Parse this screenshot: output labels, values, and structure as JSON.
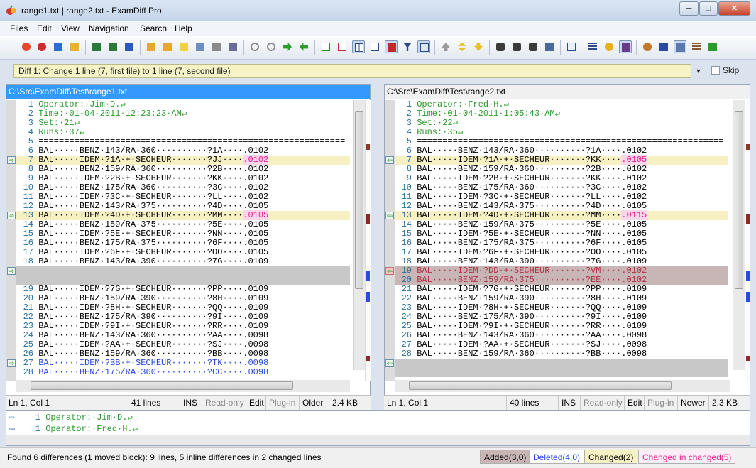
{
  "window": {
    "title": "range1.txt  |  range2.txt - ExamDiff Pro",
    "min": "─",
    "max": "□",
    "close": "✕"
  },
  "menu": [
    "Files",
    "Edit",
    "View",
    "Navigation",
    "Search",
    "Help"
  ],
  "diff_nav": {
    "current": "Diff 1: Change 1 line (7, first file) to 1 line (7, second file)",
    "skip_label": "Skip"
  },
  "colors": {
    "added": "#c8b5b5",
    "deleted": "#2a48e0",
    "changed": "#f7f0c2",
    "inline": "#e5208e"
  },
  "left": {
    "path": "C:\\Src\\ExamDiff\\Test\\range1.txt",
    "lines": [
      {
        "n": "1",
        "t": "Operator:·Jim·D.↵",
        "k": "green"
      },
      {
        "n": "2",
        "t": "Time:·01-04-2011·12:23:23·AM↵",
        "k": "green"
      },
      {
        "n": "3",
        "t": "Set:·21↵",
        "k": "green"
      },
      {
        "n": "4",
        "t": "Runs:·37↵",
        "k": "green"
      },
      {
        "n": "5",
        "t": "============================================================",
        "k": "ok"
      },
      {
        "n": "6",
        "t": "BAL·····BENZ·143/RA·360··········?1A····.0102",
        "k": "ok"
      },
      {
        "n": "7",
        "t": "BAL·····IDEM·?1A·+·SECHEUR·······?JJ····",
        "hl": ".0102",
        "k": "chg",
        "m": "⇨"
      },
      {
        "n": "8",
        "t": "BAL·····BENZ·159/RA·360··········?2B····.0102",
        "k": "ok"
      },
      {
        "n": "9",
        "t": "BAL·····IDEM·?2B·+·SECHEUR·······?KK····.0102",
        "k": "ok"
      },
      {
        "n": "10",
        "t": "BAL·····BENZ·175/RA·360··········?3C····.0102",
        "k": "ok"
      },
      {
        "n": "11",
        "t": "BAL·····IDEM·?3C·+·SECHEUR·······?LL····.0102",
        "k": "ok"
      },
      {
        "n": "12",
        "t": "BAL·····BENZ·143/RA·375··········?4D····.0105",
        "k": "ok"
      },
      {
        "n": "13",
        "t": "BAL·····IDEM·?4D·+·SECHEUR·······?MM····",
        "hl": ".0105",
        "k": "chg",
        "m": "⇨"
      },
      {
        "n": "14",
        "t": "BAL·····BENZ·159/RA·375··········?5E····.0105",
        "k": "ok"
      },
      {
        "n": "15",
        "t": "BAL·····IDEM·?5E·+·SECHEUR·······?NN····.0105",
        "k": "ok"
      },
      {
        "n": "16",
        "t": "BAL·····BENZ·175/RA·375··········?6F····.0105",
        "k": "ok"
      },
      {
        "n": "17",
        "t": "BAL·····IDEM·?6F·+·SECHEUR·······?OO····.0105",
        "k": "ok"
      },
      {
        "n": "18",
        "t": "BAL·····BENZ·143/RA·390··········?7G····.0109",
        "k": "ok"
      },
      {
        "n": "",
        "t": "",
        "k": "gap",
        "m": "⇨"
      },
      {
        "n": "",
        "t": "",
        "k": "gap"
      },
      {
        "n": "19",
        "t": "BAL·····IDEM·?7G·+·SECHEUR·······?PP····.0109",
        "k": "ok"
      },
      {
        "n": "20",
        "t": "BAL·····BENZ·159/RA·390··········?8H····.0109",
        "k": "ok"
      },
      {
        "n": "21",
        "t": "BAL·····IDEM·?8H·+·SECHEUR·······?QQ····.0109",
        "k": "ok"
      },
      {
        "n": "22",
        "t": "BAL·····BENZ·175/RA·390··········?9I····.0109",
        "k": "ok"
      },
      {
        "n": "23",
        "t": "BAL·····IDEM·?9I·+·SECHEUR·······?RR····.0109",
        "k": "ok"
      },
      {
        "n": "24",
        "t": "BAL·····BENZ·143/RA·360··········?AA····.0098",
        "k": "ok"
      },
      {
        "n": "25",
        "t": "BAL·····IDEM·?AA·+·SECHEUR·······?SJ····.0098",
        "k": "ok"
      },
      {
        "n": "26",
        "t": "BAL·····BENZ·159/RA·360··········?BB····.0098",
        "k": "ok"
      },
      {
        "n": "27",
        "t": "BAL·····IDEM·?BB·+·SECHEUR·······?TK····.0098",
        "k": "mov",
        "m": "⇨"
      },
      {
        "n": "28",
        "t": "BAL·····BENZ·175/RA·360··········?CC····.0098",
        "k": "mov"
      }
    ],
    "status": {
      "pos": "Ln 1, Col 1",
      "lines": "41 lines",
      "ins": "INS",
      "ro": "Read-only",
      "edit": "Edit",
      "plugin": "Plug-in",
      "age": "Older",
      "size": "2.4 KB"
    }
  },
  "right": {
    "path": "C:\\Src\\ExamDiff\\Test\\range2.txt",
    "lines": [
      {
        "n": "1",
        "t": "Operator:·Fred·H.↵",
        "k": "green"
      },
      {
        "n": "2",
        "t": "Time:·01-04-2011·1:05:43·AM↵",
        "k": "green"
      },
      {
        "n": "3",
        "t": "Set:·22↵",
        "k": "green"
      },
      {
        "n": "4",
        "t": "Runs:·35↵",
        "k": "green"
      },
      {
        "n": "5",
        "t": "============================================================",
        "k": "ok"
      },
      {
        "n": "6",
        "t": "BAL·····BENZ·143/RA·360··········?1A····.0102",
        "k": "ok"
      },
      {
        "n": "7",
        "t": "BAL·····IDEM·?1A·+·SECHEUR·······?KK····",
        "hl": ".0105",
        "k": "chg",
        "m": "⇦"
      },
      {
        "n": "8",
        "t": "BAL·····BENZ·159/RA·360··········?2B····.0102",
        "k": "ok"
      },
      {
        "n": "9",
        "t": "BAL·····IDEM·?2B·+·SECHEUR·······?KK····.0102",
        "k": "ok"
      },
      {
        "n": "10",
        "t": "BAL·····BENZ·175/RA·360··········?3C····.0102",
        "k": "ok"
      },
      {
        "n": "11",
        "t": "BAL·····IDEM·?3C·+·SECHEUR·······?LL····.0102",
        "k": "ok"
      },
      {
        "n": "12",
        "t": "BAL·····BENZ·143/RA·375··········?4D····.0105",
        "k": "ok"
      },
      {
        "n": "13",
        "t": "BAL·····IDEM·?4D·+·SECHEUR·······?MM····",
        "hl": ".0115",
        "k": "chg",
        "m": "⇦"
      },
      {
        "n": "14",
        "t": "BAL·····BENZ·159/RA·375··········?5E····.0105",
        "k": "ok"
      },
      {
        "n": "15",
        "t": "BAL·····IDEM·?5E·+·SECHEUR·······?NN····.0105",
        "k": "ok"
      },
      {
        "n": "16",
        "t": "BAL·····BENZ·175/RA·375··········?6F····.0105",
        "k": "ok"
      },
      {
        "n": "17",
        "t": "BAL·····IDEM·?6F·+·SECHEUR·······?OO····.0105",
        "k": "ok"
      },
      {
        "n": "18",
        "t": "BAL·····BENZ·143/RA·390··········?7G····.0109",
        "k": "ok"
      },
      {
        "n": "19",
        "t": "BAL·····IDEM·?DD·+·SECHEUR·······?VM····.0102",
        "k": "del",
        "m": "⇦"
      },
      {
        "n": "20",
        "t": "BAL·····BENZ·159/RA·375··········?EE····.0102",
        "k": "del"
      },
      {
        "n": "21",
        "t": "BAL·····IDEM·?7G·+·SECHEUR·······?PP····.0109",
        "k": "ok"
      },
      {
        "n": "22",
        "t": "BAL·····BENZ·159/RA·390··········?8H····.0109",
        "k": "ok"
      },
      {
        "n": "23",
        "t": "BAL·····IDEM·?8H·+·SECHEUR·······?QQ····.0109",
        "k": "ok"
      },
      {
        "n": "24",
        "t": "BAL·····BENZ·175/RA·390··········?9I····.0109",
        "k": "ok"
      },
      {
        "n": "25",
        "t": "BAL·····IDEM·?9I·+·SECHEUR·······?RR····.0109",
        "k": "ok"
      },
      {
        "n": "26",
        "t": "BAL·····BENZ·143/RA·360··········?AA····.0098",
        "k": "ok"
      },
      {
        "n": "27",
        "t": "BAL·····IDEM·?AA·+·SECHEUR·······?SJ····.0098",
        "k": "ok"
      },
      {
        "n": "28",
        "t": "BAL·····BENZ·159/RA·360··········?BB····.0098",
        "k": "ok"
      },
      {
        "n": "",
        "t": "",
        "k": "gap",
        "m": "⇦"
      },
      {
        "n": "",
        "t": "",
        "k": "gap"
      }
    ],
    "status": {
      "pos": "Ln 1, Col 1",
      "lines": "40 lines",
      "ins": "INS",
      "ro": "Read-only",
      "edit": "Edit",
      "plugin": "Plug-in",
      "age": "Newer",
      "size": "2.3 KB"
    }
  },
  "compare": [
    {
      "n": "1",
      "t": "Operator:·Jim·D.↵",
      "arrow": "⇨"
    },
    {
      "n": "1",
      "t": "Operator:·Fred·H.↵",
      "arrow": "⇦"
    }
  ],
  "statusbar": {
    "summary": "Found 6 differences (1 moved block): 9 lines, 5 inline differences in 2 changed lines",
    "added": "Added(3,0)",
    "deleted": "Deleted(4,0)",
    "changed": "Changed(2)",
    "inline": "Changed in changed(5)"
  }
}
